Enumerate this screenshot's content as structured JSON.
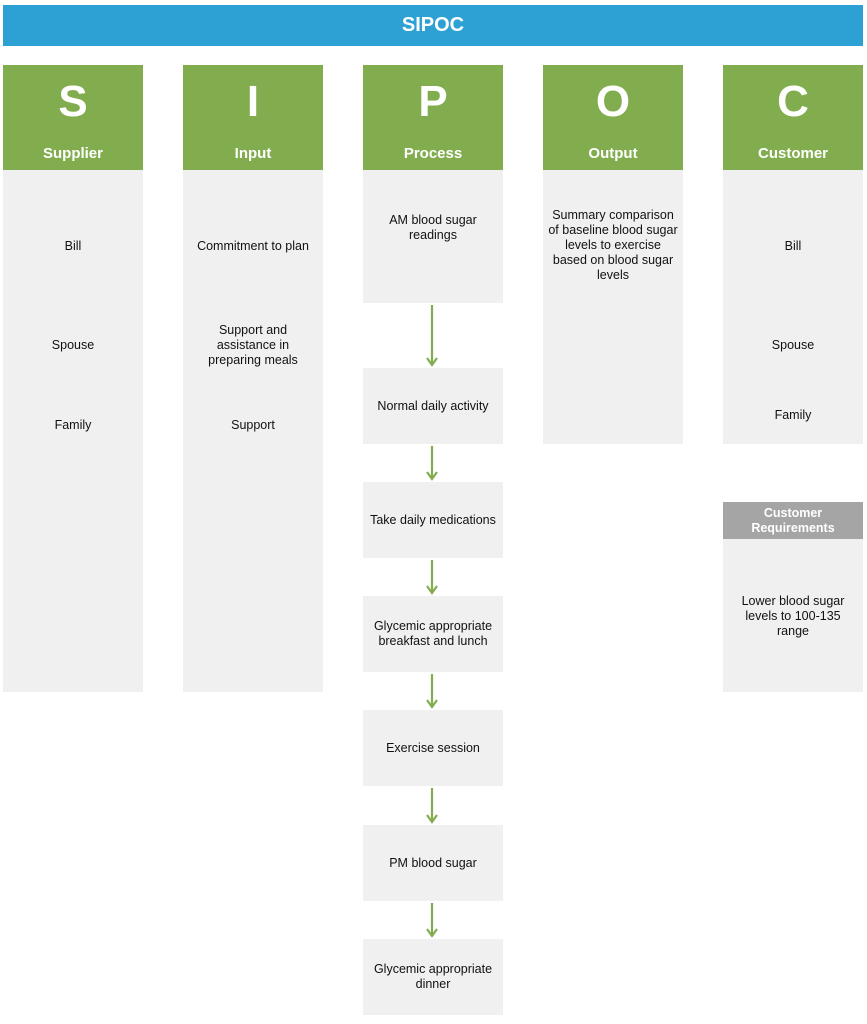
{
  "title": "SIPOC",
  "colors": {
    "title_bar": "#2ea1d4",
    "column_header": "#82ad4f",
    "box_fill": "#f0f0f0",
    "requirements_header": "#a5a5a5",
    "arrow": "#82ad4f"
  },
  "columns": [
    {
      "letter": "S",
      "name": "Supplier",
      "items": [
        "Bill",
        "Spouse",
        "Family"
      ]
    },
    {
      "letter": "I",
      "name": "Input",
      "items": [
        "Commitment to plan",
        "Support and assistance in preparing meals",
        "Support"
      ]
    },
    {
      "letter": "P",
      "name": "Process",
      "steps": [
        "AM blood sugar readings",
        "Normal daily activity",
        "Take daily medications",
        "Glycemic appropriate breakfast and lunch",
        "Exercise session",
        "PM blood sugar",
        "Glycemic appropriate dinner"
      ]
    },
    {
      "letter": "O",
      "name": "Output",
      "items": [
        "Summary comparison of baseline blood sugar levels to exercise based on blood sugar levels"
      ]
    },
    {
      "letter": "C",
      "name": "Customer",
      "items": [
        "Bill",
        "Spouse",
        "Family"
      ]
    }
  ],
  "customer_requirements": {
    "header": "Customer Requirements",
    "items": [
      "Lower blood sugar levels to 100-135 range"
    ]
  }
}
